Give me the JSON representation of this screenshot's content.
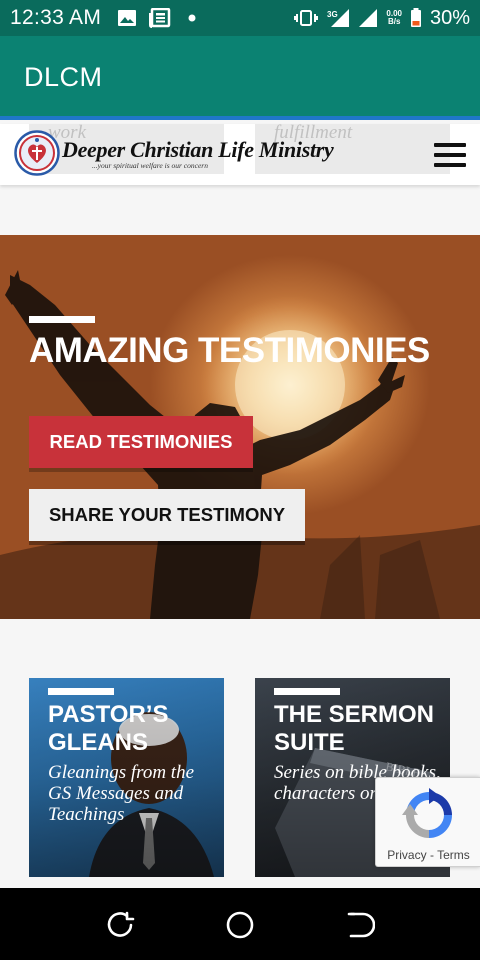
{
  "status_bar": {
    "time": "12:33 AM",
    "left_icons": [
      "image-icon",
      "news-icon",
      "dot-icon"
    ],
    "network": "3G",
    "net_speed_value": "0.00",
    "net_speed_unit": "B/s",
    "battery_percent": "30%"
  },
  "app_bar": {
    "title": "DLCM",
    "accent": "#0b8272"
  },
  "site_header": {
    "logo_name": "Deeper Christian Life Ministry",
    "logo_tagline": "...your spiritual welfare is our concern",
    "ghost_left": "work",
    "ghost_right": "fulfillment"
  },
  "hero": {
    "title": "AMAZING TESTIMONIES",
    "read_button": "READ TESTIMONIES",
    "share_button": "SHARE YOUR TESTIMONY",
    "read_color": "#c8323a"
  },
  "cards": [
    {
      "title": "PASTOR’S GLEANS",
      "description": "Gleanings from the GS Messages and Teachings"
    },
    {
      "title": "THE SERMON SUITE",
      "description": "Series on bible books, characters or titles"
    }
  ],
  "recaptcha": {
    "privacy": "Privacy",
    "separator": "-",
    "terms": "Terms"
  },
  "nav_bar": {
    "buttons": [
      "recent-apps-icon",
      "home-icon",
      "back-icon"
    ]
  }
}
